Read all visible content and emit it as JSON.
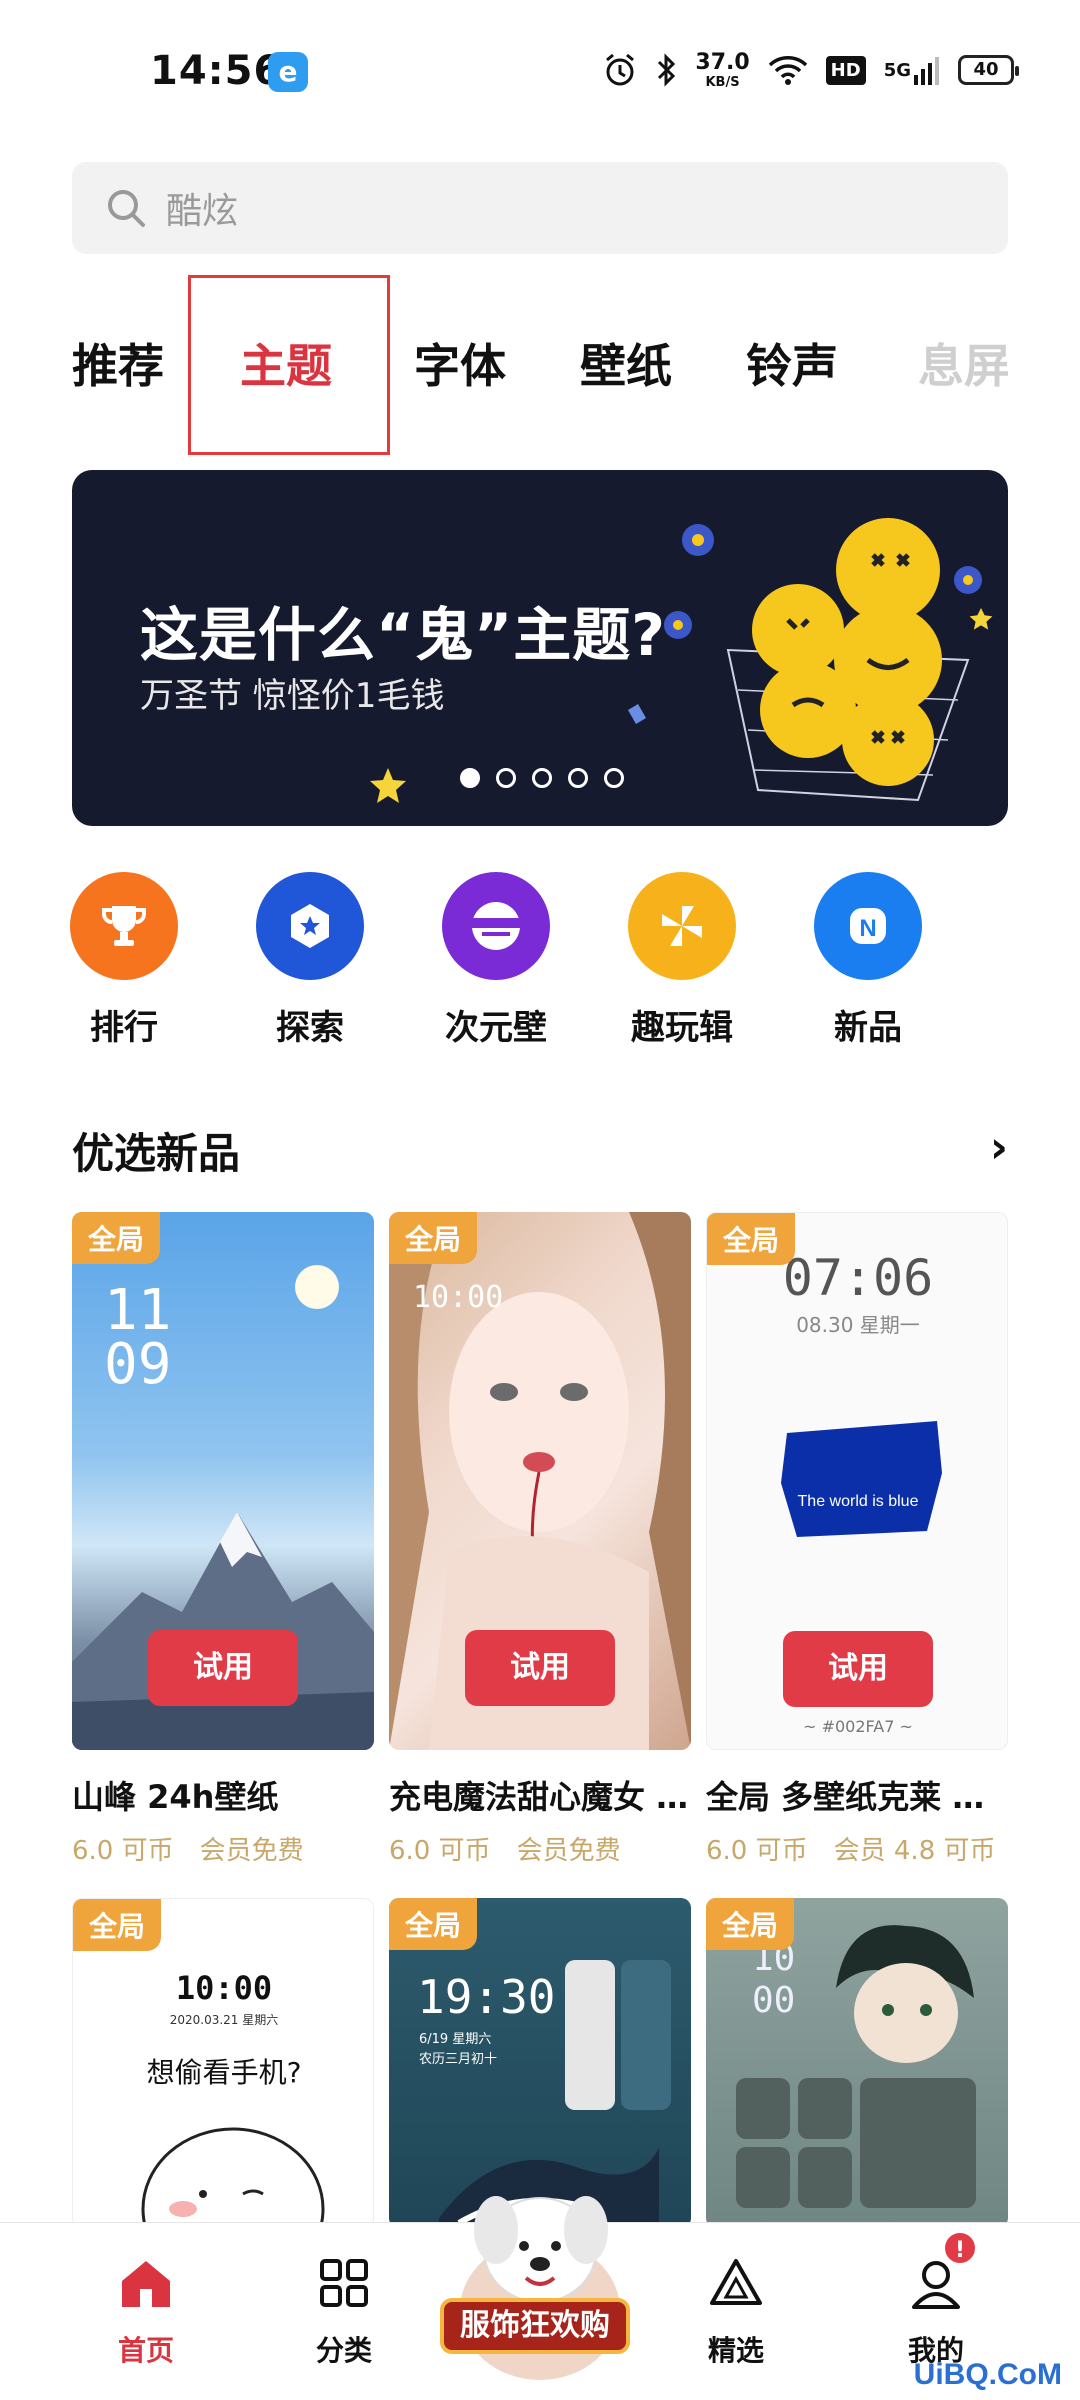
{
  "status_bar": {
    "time": "14:56",
    "net_speed_value": "37.0",
    "net_speed_unit": "KB/S",
    "hd": "HD",
    "signal": "5G",
    "battery": "40"
  },
  "search": {
    "placeholder": "酷炫"
  },
  "tabs": [
    {
      "label": "推荐"
    },
    {
      "label": "主题",
      "active": true
    },
    {
      "label": "字体"
    },
    {
      "label": "壁纸"
    },
    {
      "label": "铃声"
    },
    {
      "label": "息屏"
    }
  ],
  "banner": {
    "title": "这是什么“鬼”主题?",
    "subtitle": "万圣节 惊怪价1毛钱",
    "slide_count": 5,
    "current_slide": 1
  },
  "shortcuts": [
    {
      "label": "排行",
      "color": "#f5741d",
      "icon": "trophy-icon"
    },
    {
      "label": "探索",
      "color": "#2056d8",
      "icon": "explore-icon"
    },
    {
      "label": "次元壁",
      "color": "#7a2bd6",
      "icon": "dimension-icon"
    },
    {
      "label": "趣玩辑",
      "color": "#f7b21b",
      "icon": "pinwheel-icon"
    },
    {
      "label": "新品",
      "color": "#1a7ef0",
      "icon": "new-icon"
    }
  ],
  "section": {
    "title": "优选新品",
    "more": "›"
  },
  "cards": [
    {
      "tag": "全局",
      "try": "试用",
      "title": "山峰 24h壁纸",
      "price": "6.0 可币",
      "member": "会员免费",
      "preview_hour": "11",
      "preview_min": "09"
    },
    {
      "tag": "全局",
      "try": "试用",
      "title": "充电魔法甜心魔女 …",
      "price": "6.0 可币",
      "member": "会员免费",
      "preview_time": "10:00"
    },
    {
      "tag": "全局",
      "try": "试用",
      "title": "全局 多壁纸克莱 …",
      "price": "6.0 可币",
      "member": "会员 4.8 可币",
      "preview_time": "07:06",
      "preview_date": "08.30 星期一",
      "preview_text": "The world is blue",
      "preview_code": "~ #002FA7 ~"
    },
    {
      "tag": "全局",
      "preview_time": "10:00",
      "preview_date": "2020.03.21 星期六",
      "preview_text": "想偷看手机?"
    },
    {
      "tag": "全局",
      "preview_time": "19:30",
      "preview_date": "6/19 星期六",
      "preview_sub": "农历三月初十"
    },
    {
      "tag": "全局",
      "preview_hour": "10",
      "preview_min": "00"
    }
  ],
  "bottom_nav": {
    "home": "首页",
    "category": "分类",
    "promo": "服饰狂欢购",
    "featured": "精选",
    "mine": "我的",
    "badge": "!"
  },
  "watermark": "UiBQ.CoM"
}
